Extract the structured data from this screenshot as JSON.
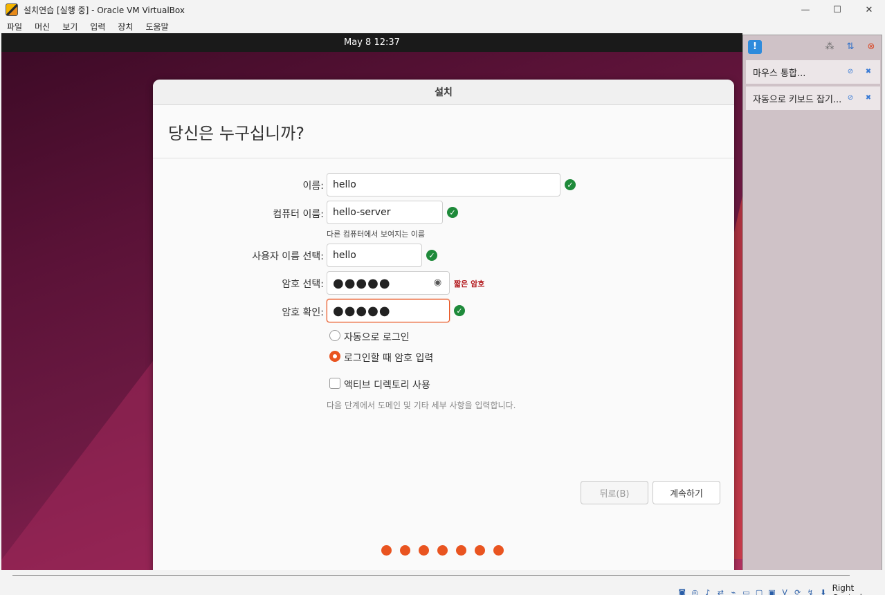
{
  "window": {
    "title": "설치연습 [실행 중] - Oracle VM VirtualBox",
    "controls": [
      "—",
      "☐",
      "✕"
    ]
  },
  "menu": [
    "파일",
    "머신",
    "보기",
    "입력",
    "장치",
    "도움말"
  ],
  "guest": {
    "clock": "May 8  12:37",
    "dialog_title": "설치",
    "heading": "당신은 누구십니까?",
    "form": {
      "name_label": "이름:",
      "name_value": "hello",
      "computer_label": "컴퓨터 이름:",
      "computer_value": "hello-server",
      "computer_hint": "다른 컴퓨터에서 보여지는 이름",
      "username_label": "사용자 이름 선택:",
      "username_value": "hello",
      "password_label": "암호 선택:",
      "password_value": "●●●●●",
      "password_strength": "짧은 암호",
      "confirm_label": "암호 확인:",
      "confirm_value": "●●●●●"
    },
    "options": {
      "auto_login": "자동으로 로그인",
      "require_password": "로그인할 때 암호 입력",
      "active_directory": "액티브 디렉토리 사용",
      "ad_note": "다음 단계에서 도메인 및 기타 세부 사항을 입력합니다."
    },
    "buttons": {
      "back": "뒤로(B)",
      "continue": "계속하기"
    },
    "progress": {
      "total_steps": 7,
      "completed": 7
    }
  },
  "notifications": {
    "items": [
      "마우스 통합...",
      "자동으로 키보드 잡기..."
    ]
  },
  "statusbar": {
    "host_key": "Right Control"
  },
  "colors": {
    "accent": "#e95420",
    "ok": "#1e8a3a",
    "warning": "#b3191d"
  }
}
